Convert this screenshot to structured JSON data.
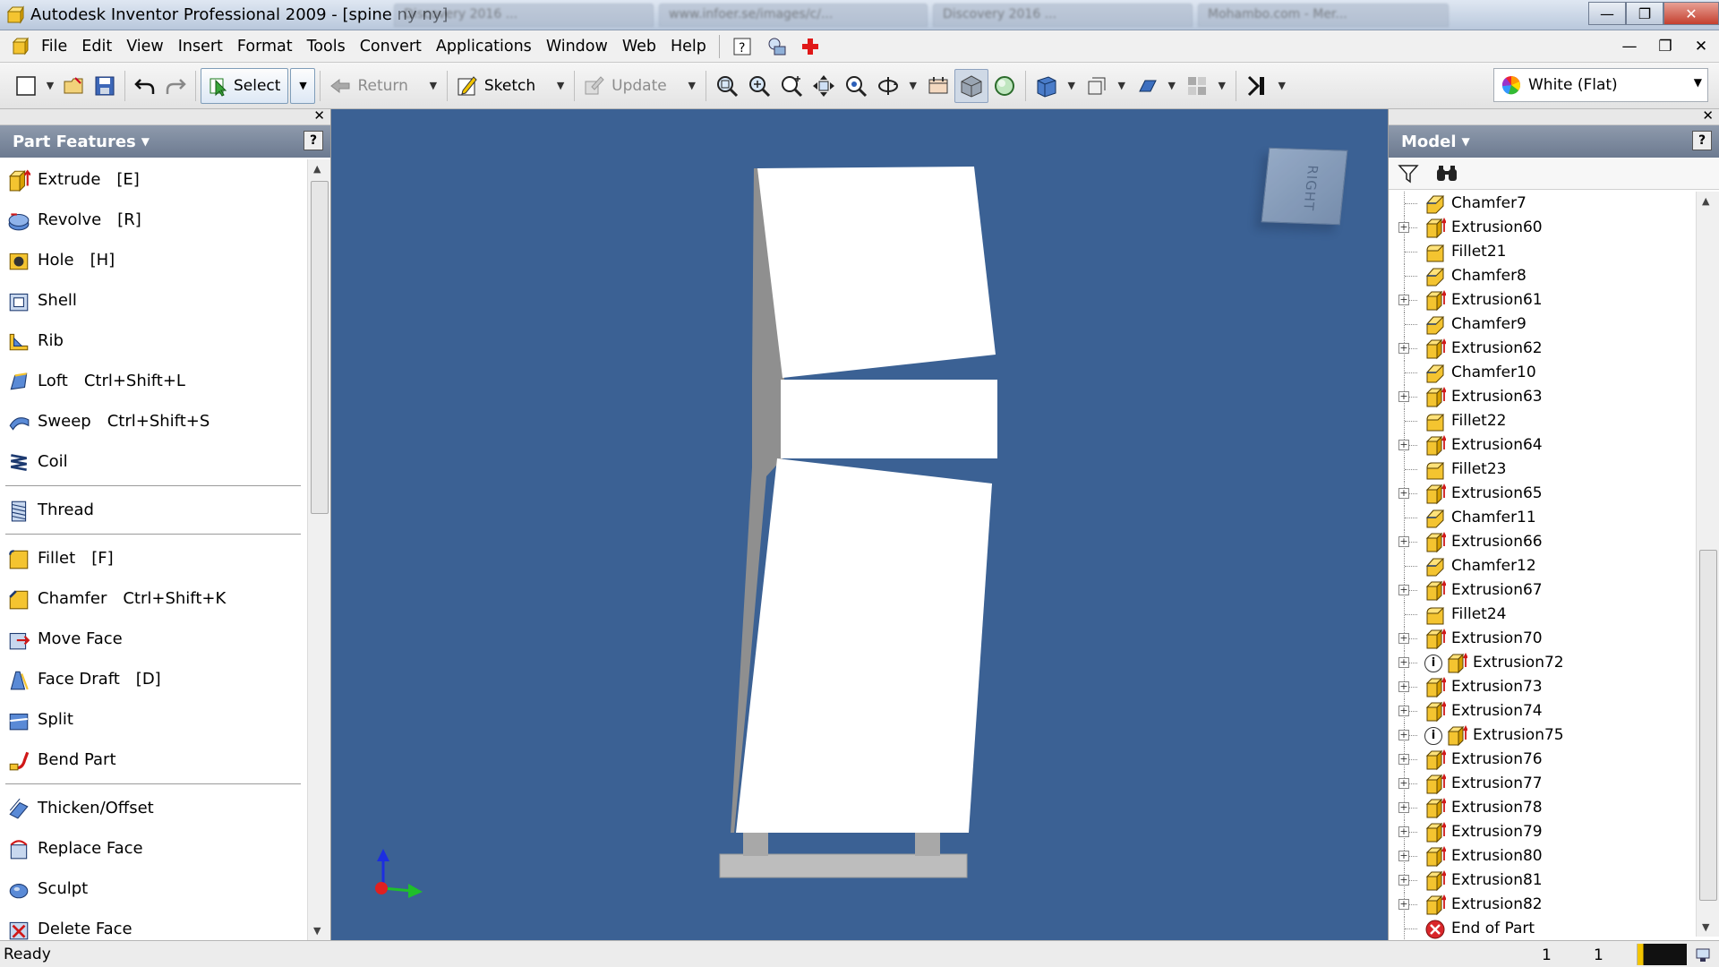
{
  "window": {
    "title": "Autodesk Inventor Professional 2009 - [spine ny ny]",
    "background_tabs": [
      "Discovery 2016 ...",
      "www.infoer.se/images/c/...",
      "Discovery 2016 ...",
      "Mohambo.com - Mer..."
    ]
  },
  "menu": {
    "items": [
      "File",
      "Edit",
      "View",
      "Insert",
      "Format",
      "Tools",
      "Convert",
      "Applications",
      "Window",
      "Web",
      "Help"
    ]
  },
  "toolbar": {
    "select_label": "Select",
    "return_label": "Return",
    "sketch_label": "Sketch",
    "update_label": "Update",
    "appearance_value": "White (Flat)"
  },
  "left_panel": {
    "title": "Part Features",
    "features": [
      {
        "label": "Extrude",
        "shortcut": "[E]",
        "icon": "extrude-icon"
      },
      {
        "label": "Revolve",
        "shortcut": "[R]",
        "icon": "revolve-icon"
      },
      {
        "label": "Hole",
        "shortcut": "[H]",
        "icon": "hole-icon"
      },
      {
        "label": "Shell",
        "shortcut": "",
        "icon": "shell-icon"
      },
      {
        "label": "Rib",
        "shortcut": "",
        "icon": "rib-icon"
      },
      {
        "label": "Loft",
        "shortcut": "Ctrl+Shift+L",
        "icon": "loft-icon"
      },
      {
        "label": "Sweep",
        "shortcut": "Ctrl+Shift+S",
        "icon": "sweep-icon"
      },
      {
        "label": "Coil",
        "shortcut": "",
        "icon": "coil-icon"
      },
      {
        "label": "Thread",
        "shortcut": "",
        "icon": "thread-icon"
      },
      {
        "label": "Fillet",
        "shortcut": "[F]",
        "icon": "fillet-icon"
      },
      {
        "label": "Chamfer",
        "shortcut": "Ctrl+Shift+K",
        "icon": "chamfer-icon"
      },
      {
        "label": "Move Face",
        "shortcut": "",
        "icon": "move-face-icon"
      },
      {
        "label": "Face Draft",
        "shortcut": "[D]",
        "icon": "face-draft-icon"
      },
      {
        "label": "Split",
        "shortcut": "",
        "icon": "split-icon"
      },
      {
        "label": "Bend Part",
        "shortcut": "",
        "icon": "bend-part-icon"
      },
      {
        "label": "Thicken/Offset",
        "shortcut": "",
        "icon": "thicken-offset-icon"
      },
      {
        "label": "Replace Face",
        "shortcut": "",
        "icon": "replace-face-icon"
      },
      {
        "label": "Sculpt",
        "shortcut": "",
        "icon": "sculpt-icon"
      },
      {
        "label": "Delete Face",
        "shortcut": "",
        "icon": "delete-face-icon"
      }
    ]
  },
  "viewcube": {
    "face_label": "RIGHT"
  },
  "right_panel": {
    "title": "Model",
    "tree": [
      {
        "label": "Chamfer7",
        "type": "chamfer",
        "expandable": false,
        "warning": false
      },
      {
        "label": "Extrusion60",
        "type": "extrusion",
        "expandable": true,
        "warning": false
      },
      {
        "label": "Fillet21",
        "type": "fillet",
        "expandable": false,
        "warning": false
      },
      {
        "label": "Chamfer8",
        "type": "chamfer",
        "expandable": false,
        "warning": false
      },
      {
        "label": "Extrusion61",
        "type": "extrusion",
        "expandable": true,
        "warning": false
      },
      {
        "label": "Chamfer9",
        "type": "chamfer",
        "expandable": false,
        "warning": false
      },
      {
        "label": "Extrusion62",
        "type": "extrusion",
        "expandable": true,
        "warning": false
      },
      {
        "label": "Chamfer10",
        "type": "chamfer",
        "expandable": false,
        "warning": false
      },
      {
        "label": "Extrusion63",
        "type": "extrusion",
        "expandable": true,
        "warning": false
      },
      {
        "label": "Fillet22",
        "type": "fillet",
        "expandable": false,
        "warning": false
      },
      {
        "label": "Extrusion64",
        "type": "extrusion",
        "expandable": true,
        "warning": false
      },
      {
        "label": "Fillet23",
        "type": "fillet",
        "expandable": false,
        "warning": false
      },
      {
        "label": "Extrusion65",
        "type": "extrusion",
        "expandable": true,
        "warning": false
      },
      {
        "label": "Chamfer11",
        "type": "chamfer",
        "expandable": false,
        "warning": false
      },
      {
        "label": "Extrusion66",
        "type": "extrusion",
        "expandable": true,
        "warning": false
      },
      {
        "label": "Chamfer12",
        "type": "chamfer",
        "expandable": false,
        "warning": false
      },
      {
        "label": "Extrusion67",
        "type": "extrusion",
        "expandable": true,
        "warning": false
      },
      {
        "label": "Fillet24",
        "type": "fillet",
        "expandable": false,
        "warning": false
      },
      {
        "label": "Extrusion70",
        "type": "extrusion",
        "expandable": true,
        "warning": false
      },
      {
        "label": "Extrusion72",
        "type": "extrusion",
        "expandable": true,
        "warning": true
      },
      {
        "label": "Extrusion73",
        "type": "extrusion",
        "expandable": true,
        "warning": false
      },
      {
        "label": "Extrusion74",
        "type": "extrusion",
        "expandable": true,
        "warning": false
      },
      {
        "label": "Extrusion75",
        "type": "extrusion",
        "expandable": true,
        "warning": true
      },
      {
        "label": "Extrusion76",
        "type": "extrusion",
        "expandable": true,
        "warning": false
      },
      {
        "label": "Extrusion77",
        "type": "extrusion",
        "expandable": true,
        "warning": false
      },
      {
        "label": "Extrusion78",
        "type": "extrusion",
        "expandable": true,
        "warning": false
      },
      {
        "label": "Extrusion79",
        "type": "extrusion",
        "expandable": true,
        "warning": false
      },
      {
        "label": "Extrusion80",
        "type": "extrusion",
        "expandable": true,
        "warning": false
      },
      {
        "label": "Extrusion81",
        "type": "extrusion",
        "expandable": true,
        "warning": false
      },
      {
        "label": "Extrusion82",
        "type": "extrusion",
        "expandable": true,
        "warning": false
      },
      {
        "label": "End of Part",
        "type": "end",
        "expandable": false,
        "warning": false
      }
    ]
  },
  "status": {
    "text": "Ready",
    "count_a": "1",
    "count_b": "1"
  },
  "colors": {
    "viewport_bg": "#3b6194",
    "panel_header": "#7a879b",
    "extrusion_icon": "#f5c21b",
    "end_marker": "#d9262a"
  }
}
